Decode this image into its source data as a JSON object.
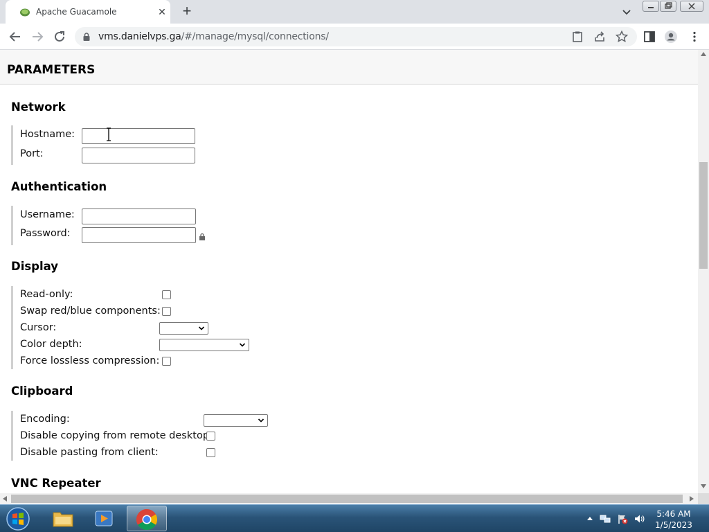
{
  "browser": {
    "tab_title": "Apache Guacamole",
    "url_host": "vms.danielvps.ga",
    "url_path": "/#/manage/mysql/connections/"
  },
  "page": {
    "section_title": "PARAMETERS",
    "groups": {
      "network": {
        "title": "Network",
        "hostname_label": "Hostname:",
        "hostname_value": "",
        "port_label": "Port:",
        "port_value": ""
      },
      "authentication": {
        "title": "Authentication",
        "username_label": "Username:",
        "username_value": "",
        "password_label": "Password:",
        "password_value": ""
      },
      "display": {
        "title": "Display",
        "read_only_label": "Read-only:",
        "swap_label": "Swap red/blue components:",
        "cursor_label": "Cursor:",
        "cursor_value": "",
        "color_depth_label": "Color depth:",
        "color_depth_value": "",
        "lossless_label": "Force lossless compression:"
      },
      "clipboard": {
        "title": "Clipboard",
        "encoding_label": "Encoding:",
        "encoding_value": "",
        "disable_copy_label": "Disable copying from remote desktop:",
        "disable_paste_label": "Disable pasting from client:"
      },
      "vnc_repeater": {
        "title": "VNC Repeater"
      }
    }
  },
  "taskbar": {
    "time": "5:46 AM",
    "date": "1/5/2023"
  },
  "colors": {
    "chrome_tabbar": "#dee1e6",
    "section_header_bg": "#f7f7f7",
    "group_bar": "#d0d0d0",
    "taskbar": "#2a5478"
  }
}
